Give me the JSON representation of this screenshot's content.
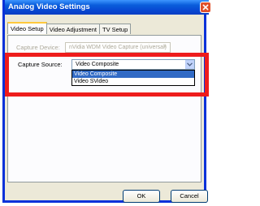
{
  "window": {
    "title": "Analog Video Settings"
  },
  "tabs": [
    {
      "label": "Video Setup",
      "active": true
    },
    {
      "label": "Video Adjustment",
      "active": false
    },
    {
      "label": "TV Setup",
      "active": false
    }
  ],
  "capture_device": {
    "label": "Capture Device:",
    "value": "nVidia WDM Video Capture (universal)",
    "enabled": false
  },
  "capture_source": {
    "label": "Capture Source:",
    "value": "Video Composite",
    "options": [
      "Video Composite",
      "Video SVideo"
    ],
    "selected_index": 0
  },
  "buttons": {
    "ok": "OK",
    "cancel": "Cancel"
  },
  "colors": {
    "highlight": "#ee1c1c",
    "titlebar": "#0a5ddb",
    "selection": "#316ac5"
  }
}
